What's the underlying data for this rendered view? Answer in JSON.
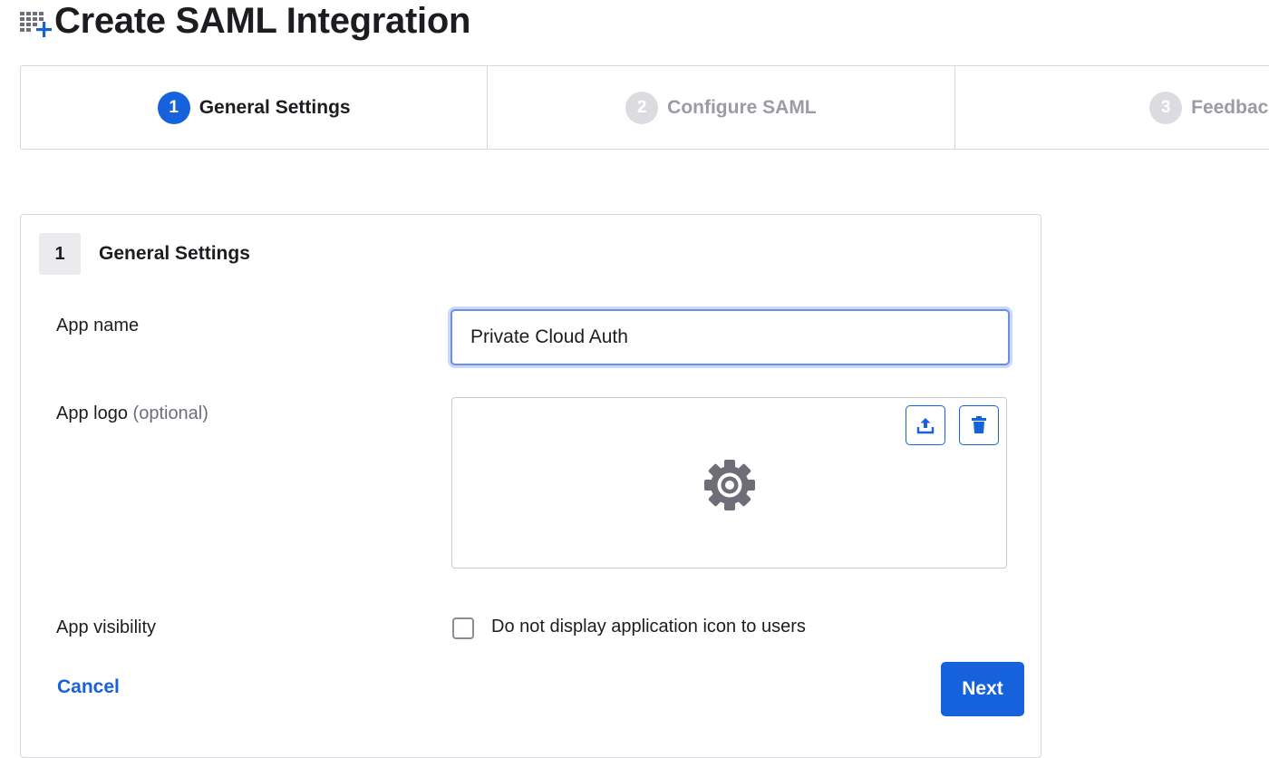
{
  "header": {
    "title": "Create SAML Integration",
    "icon": "grid-add-icon"
  },
  "stepper": {
    "steps": [
      {
        "number": "1",
        "label": "General Settings",
        "state": "active"
      },
      {
        "number": "2",
        "label": "Configure SAML",
        "state": "inactive"
      },
      {
        "number": "3",
        "label": "Feedback",
        "state": "inactive"
      }
    ]
  },
  "section": {
    "number": "1",
    "title": "General Settings"
  },
  "form": {
    "app_name_label": "App name",
    "app_name_value": "Private Cloud Auth",
    "app_logo_label": "App logo",
    "app_logo_optional": "(optional)",
    "app_visibility_label": "App visibility",
    "visibility_checkbox_label": "Do not display application icon to users",
    "visibility_checked": false
  },
  "actions": {
    "cancel_label": "Cancel",
    "next_label": "Next"
  },
  "colors": {
    "accent": "#1662dd",
    "inactive_step": "#dcdce0",
    "inactive_text": "#9b9ba4"
  }
}
